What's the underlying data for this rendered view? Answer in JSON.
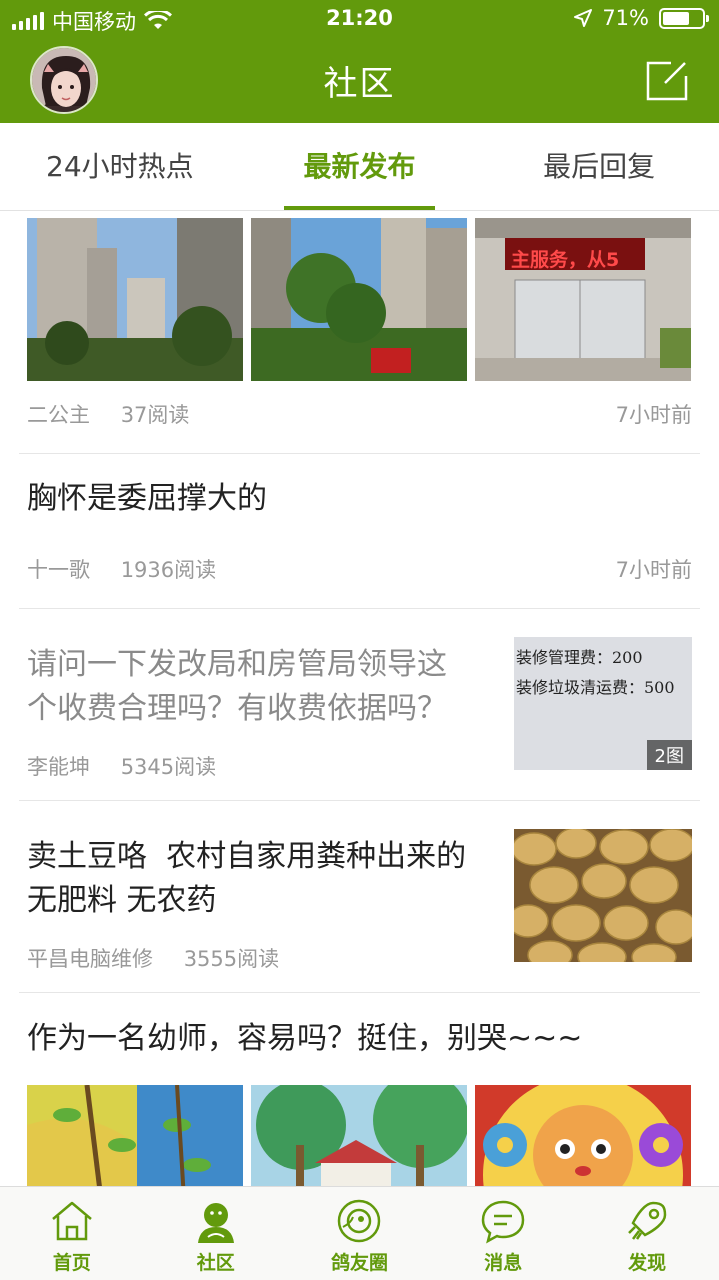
{
  "status": {
    "carrier": "中国移动",
    "time": "21:20",
    "battery": "71%",
    "battery_level": 0.71
  },
  "header": {
    "title": "社区"
  },
  "tabs": [
    {
      "label": "24小时热点",
      "active": false
    },
    {
      "label": "最新发布",
      "active": true
    },
    {
      "label": "最后回复",
      "active": false
    }
  ],
  "posts": [
    {
      "author": "二公主",
      "reads": "37阅读",
      "time": "7小时前",
      "banner_text": "主服务，从5"
    },
    {
      "title": "胸怀是委屈撑大的",
      "author": "十一歌",
      "reads": "1936阅读",
      "time": "7小时前"
    },
    {
      "title_line1": "请问一下发改局和房管局领导这",
      "title_line2": "个收费合理吗？有收费依据吗？",
      "author": "李能坤",
      "reads": "5345阅读",
      "image_count": "2图",
      "note_lines": [
        "装修管理费：200",
        "装修垃圾清运费：500"
      ]
    },
    {
      "title_line1": "卖土豆咯  农村自家用粪种出来的",
      "title_line2": "无肥料 无农药",
      "author": "平昌电脑维修",
      "reads": "3555阅读"
    },
    {
      "title": "作为一名幼师，容易吗？挺住，别哭~~~"
    }
  ],
  "nav": [
    {
      "label": "首页",
      "icon": "home-icon"
    },
    {
      "label": "社区",
      "icon": "community-icon"
    },
    {
      "label": "鸽友圈",
      "icon": "pigeon-circle-icon"
    },
    {
      "label": "消息",
      "icon": "message-icon"
    },
    {
      "label": "发现",
      "icon": "rocket-icon"
    }
  ],
  "colors": {
    "brand": "#629a0c",
    "meta": "#999999",
    "read_title": "#8a8a8a"
  }
}
